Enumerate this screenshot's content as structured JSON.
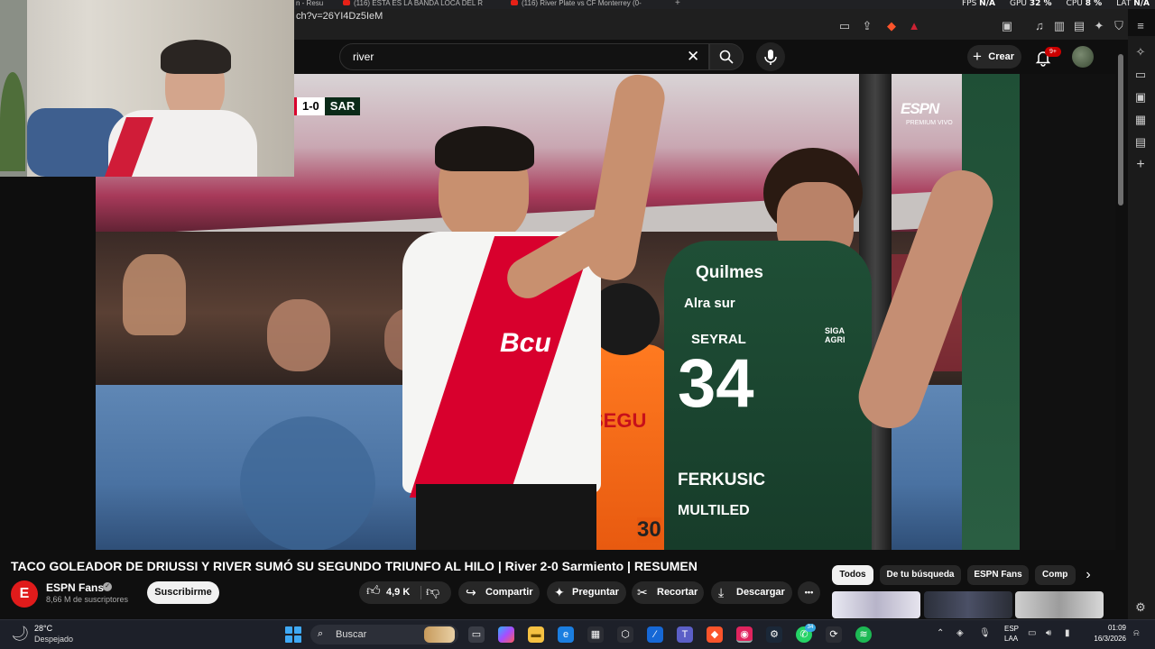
{
  "browser": {
    "tabs": [
      {
        "label": "n - Resu"
      },
      {
        "label": "(116) ESTA ES LA BANDA LOCA DEL R"
      },
      {
        "label": "(116) River Plate vs CF Monterrey (0-"
      }
    ],
    "url": "ch?v=26YI4Dz5IeM",
    "perf": {
      "fps_label": "FPS",
      "fps_value": "N/A",
      "gpu_label": "GPU",
      "gpu_value": "32 %",
      "cpu_label": "CPU",
      "cpu_value": "8 %",
      "lat_label": "LAT",
      "lat_value": "N/A"
    }
  },
  "header": {
    "search_value": "river",
    "create_label": "Crear",
    "notifications_badge": "9+"
  },
  "video": {
    "scoreboard": {
      "score": "1-0",
      "team": "SAR"
    },
    "broadcaster": "ESPN",
    "broadcaster_sub": "PREMIUM  VIVO",
    "title": "TACO GOLEADOR DE DRIUSSI Y RIVER SUMÓ SU SEGUNDO TRIUNFO AL HILO | River 2-0 Sarmiento | RESUMEN",
    "scene_text": {
      "sponsor_shirt": "Bcu",
      "green_shirt_brand": "Quilmes",
      "green_shirt_sponsor": "Alra sur",
      "green_player_name": "SEYRAL",
      "green_player_number": "34",
      "green_shirt_sponsor2": "FERKUSIC",
      "green_shirt_sponsor3": "MULTILED",
      "vest_text": "SEGU",
      "vest_number": "30",
      "green_shirt_side": "SIGA AGRI"
    }
  },
  "channel": {
    "avatar_letter": "E",
    "name": "ESPN Fans",
    "verified_mark": "✓",
    "subscribers": "8,66 M de suscriptores",
    "subscribe_label": "Suscribirme"
  },
  "actions": {
    "likes": "4,9 K",
    "share": "Compartir",
    "ask": "Preguntar",
    "clip": "Recortar",
    "download": "Descargar",
    "more": "•••"
  },
  "chips": [
    "Todos",
    "De tu búsqueda",
    "ESPN Fans",
    "Comp"
  ],
  "taskbar": {
    "temperature": "28°C",
    "weather": "Despejado",
    "search_placeholder": "Buscar",
    "lang1": "ESP",
    "lang2": "LAA",
    "time": "01:09",
    "date": "16/3/2026",
    "whatsapp_badge": "34"
  },
  "colors": {
    "yt_background": "#0f0f0f",
    "chip_active": "#f1f1f1",
    "pill_bg": "#272727",
    "river_red": "#d8002d",
    "sarmiento_green": "#1f4f36"
  }
}
